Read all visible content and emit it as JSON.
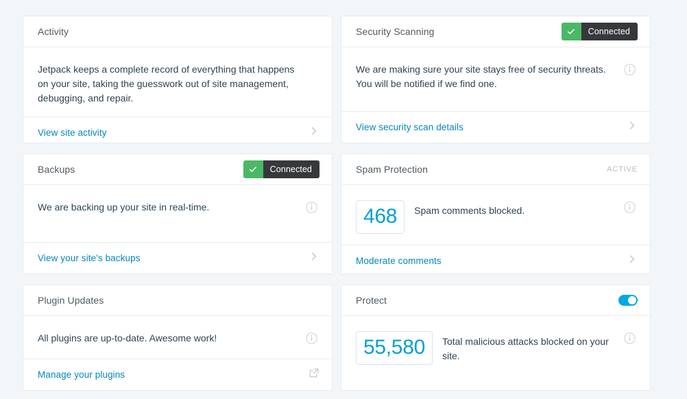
{
  "page": {
    "background_color": "#f3f6f8",
    "link_color": "#0087be",
    "accent_blue": "#00a0d2",
    "toggle_on_color": "#00a8e1",
    "badge_green": "#4ab866",
    "badge_dark": "#36393c"
  },
  "cards": [
    {
      "id": "activity",
      "title": "Activity",
      "status_type": "none",
      "status_label": "",
      "body_text": "Jetpack keeps a complete record of everything that happens on your site, taking the guesswork out of site management, debugging, and repair.",
      "has_info_icon": false,
      "footer_label": "View site activity",
      "footer_icon": "chevron-right-icon"
    },
    {
      "id": "security-scanning",
      "title": "Security Scanning",
      "status_type": "badge",
      "status_label": "Connected",
      "body_text": "We are making sure your site stays free of security threats. You will be notified if we find one.",
      "has_info_icon": true,
      "footer_label": "View security scan details",
      "footer_icon": "chevron-right-icon"
    },
    {
      "id": "backups",
      "title": "Backups",
      "status_type": "badge",
      "status_label": "Connected",
      "body_text": "We are backing up your site in real-time.",
      "has_info_icon": true,
      "footer_label": "View your site's backups",
      "footer_icon": "chevron-right-icon"
    },
    {
      "id": "spam-protection",
      "title": "Spam Protection",
      "status_type": "text",
      "status_label": "ACTIVE",
      "stat_value": "468",
      "stat_caption": "Spam comments blocked.",
      "has_info_icon": true,
      "footer_label": "Moderate comments",
      "footer_icon": "chevron-right-icon"
    },
    {
      "id": "plugin-updates",
      "title": "Plugin Updates",
      "status_type": "none",
      "status_label": "",
      "body_text": "All plugins are up-to-date. Awesome work!",
      "has_info_icon": true,
      "footer_label": "Manage your plugins",
      "footer_icon": "external-link-icon"
    },
    {
      "id": "protect",
      "title": "Protect",
      "status_type": "toggle",
      "status_label": "",
      "stat_value": "55,580",
      "stat_caption": "Total malicious attacks blocked on your site.",
      "has_info_icon": true,
      "footer_label": "",
      "footer_icon": "none"
    }
  ]
}
